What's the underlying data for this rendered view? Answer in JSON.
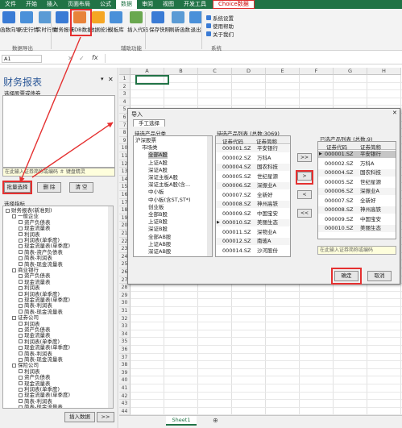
{
  "tabs": [
    "文件",
    "开始",
    "插入",
    "页面布局",
    "公式",
    "数据",
    "审阅",
    "视图",
    "开发工具",
    "Choice数据"
  ],
  "ribbon": {
    "buttons": [
      "函数向导",
      "历史行情",
      "实时行情",
      "财务报表",
      "EDB数据",
      "数据统计",
      "模板库",
      "插入代码",
      "保存快照",
      "刷新函数",
      "退出"
    ],
    "right_items": [
      "系统设置",
      "使用帮助",
      "关于我们"
    ],
    "groups": [
      "数据导出",
      "辅助功能",
      "系统"
    ]
  },
  "formula_bar": {
    "cell_ref": "A1",
    "fx": "fx"
  },
  "left_panel": {
    "title": "财务报表",
    "section_stock": "选择股票或债券",
    "search_placeholder": "在此输入证券简称或编码 ＃ 键盘精灵",
    "btn_batch": "批量选择",
    "btn_delete": "删 除",
    "btn_clear": "清 空",
    "section_indicator": "选择指标",
    "insert_button": "插入数据",
    "more_button": ">>",
    "tree": [
      "财务报表(新准则)",
      "一般企业",
      "资产负债表",
      "现金流量表",
      "利润表",
      "利润表(单季度)",
      "现金流量表(单季度)",
      "简表-资产负债表",
      "简表-利润表",
      "简表-现金流量表",
      "商业银行",
      "资产负债表",
      "现金流量表",
      "利润表",
      "利润表(单季度)",
      "现金流量表(单季度)",
      "简表-利润表",
      "简表-现金流量表",
      "证券公司",
      "利润表",
      "资产负债表",
      "现金流量表",
      "利润表(单季度)",
      "现金流量表(单季度)",
      "简表-利润表",
      "简表-现金流量表",
      "保险公司",
      "利润表",
      "资产负债表",
      "现金流量表",
      "利润表(单季度)",
      "现金流量表(单季度)",
      "简表-利润表",
      "简表-现金流量表"
    ]
  },
  "sheet": {
    "columns": [
      "A",
      "B",
      "C",
      "D",
      "E",
      "F",
      "G",
      "H"
    ],
    "rows": [
      "1",
      "2",
      "3",
      "4",
      "5",
      "6",
      "7",
      "8",
      "9",
      "10",
      "11",
      "12",
      "13",
      "14",
      "15",
      "16",
      "17",
      "18",
      "19",
      "20",
      "21",
      "22",
      "23",
      "24",
      "25",
      "26",
      "27",
      "28",
      "29",
      "30",
      "31",
      "32",
      "33",
      "34",
      "35",
      "36",
      "37",
      "38",
      "39",
      "40",
      "41",
      "42",
      "43",
      "44"
    ],
    "tab_name": "Sheet1"
  },
  "dialog": {
    "title": "导入",
    "tab": "手工选择",
    "category_header": "待选产品分类",
    "category_tree": [
      "沪深股票",
      "市场类",
      "全部A股",
      "上证A股",
      "深证A股",
      "深证主板A股",
      "深证主板A股(含...",
      "中小板",
      "中小板(含ST,ST*)",
      "创业板",
      "全部B股",
      "上证B股",
      "深证B股",
      "全部AB股",
      "上证AB股",
      "深证AB股"
    ],
    "candidate_header": "待选产品列表 (总数:3069)",
    "candidate_cols": [
      "证券代码",
      "证券简称"
    ],
    "candidates": [
      [
        "000001.SZ",
        "平安银行"
      ],
      [
        "000002.SZ",
        "万科A"
      ],
      [
        "000004.SZ",
        "国农科技"
      ],
      [
        "000005.SZ",
        "世纪星源"
      ],
      [
        "000006.SZ",
        "深振业A"
      ],
      [
        "000007.SZ",
        "全新好"
      ],
      [
        "000008.SZ",
        "神州高铁"
      ],
      [
        "000009.SZ",
        "中国宝安"
      ],
      [
        "000010.SZ",
        "美丽生态"
      ],
      [
        "000011.SZ",
        "深物业A"
      ],
      [
        "000012.SZ",
        "南玻A"
      ],
      [
        "000014.SZ",
        "沙河股份"
      ]
    ],
    "selected_header": "已选产品列表 (总数:9)",
    "selected": [
      [
        "000001.SZ",
        "平安银行"
      ],
      [
        "000002.SZ",
        "万科A"
      ],
      [
        "000004.SZ",
        "国农科技"
      ],
      [
        "000005.SZ",
        "世纪星源"
      ],
      [
        "000006.SZ",
        "深振业A"
      ],
      [
        "000007.SZ",
        "全新好"
      ],
      [
        "000008.SZ",
        "神州高铁"
      ],
      [
        "000009.SZ",
        "中国宝安"
      ],
      [
        "000010.SZ",
        "美丽生态"
      ]
    ],
    "move_buttons": [
      ">>",
      ">",
      "<",
      "<<"
    ],
    "search_placeholder": "在此输入证券简称或编码",
    "ok": "确定",
    "cancel": "取消"
  }
}
